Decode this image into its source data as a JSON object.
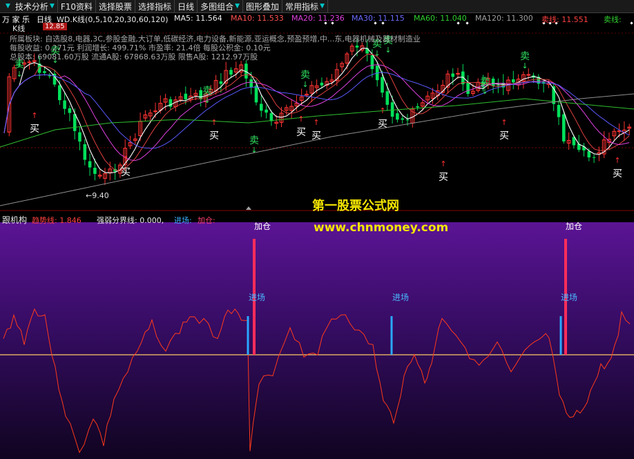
{
  "toolbar": {
    "items": [
      {
        "label": "技术分析",
        "dropdown": true
      },
      {
        "label": "F10资料",
        "dropdown": false
      },
      {
        "label": "选择股票",
        "dropdown": false
      },
      {
        "label": "选择指标",
        "dropdown": false
      },
      {
        "label": "日线",
        "dropdown": false
      },
      {
        "label": "多图组合",
        "dropdown": true
      },
      {
        "label": "图形叠加",
        "dropdown": false
      },
      {
        "label": "常用指标",
        "dropdown": true
      }
    ]
  },
  "stock": {
    "name": "万 家 乐",
    "period": "日线"
  },
  "indicator_line": {
    "name": "WD.K线(0,5,10,20,30,60,120)",
    "ma5": "MA5: 11.564",
    "ma10": "MA10: 11.533",
    "ma20": "MA20: 11.236",
    "ma30": "MA30: 11.115",
    "ma60": "MA60: 11.040",
    "ma120": "MA120: 11.300",
    "sell_line": "卖线: 11.551",
    "sell_line2": "卖线:"
  },
  "kline_label": "K线",
  "kline_badge": "12.85",
  "info": {
    "line1": "所属板块: 自选股8,电器,3C,参股金融,大订单,低碳经济,电力设备,新能源,亚运概念,预盈预增,中...东,电器机械及器材制造业",
    "line2": "每股收益: 0.271元   利润增长: 499.71%   市盈率: 21.4倍   每股公积金: 0.10元",
    "line3": "总股本: 69081.60万股   流通A股: 67868.63万股   限售A股: 1212.97万股"
  },
  "low_marker": "9.40",
  "markers": {
    "buy": "买",
    "sell": "卖"
  },
  "lower_legend": {
    "title": "跟机构",
    "trend": "趋势线: 1.846",
    "strong_weak": "强弱分界线: 0.000,",
    "entry": "进场:",
    "add": "加仓:"
  },
  "signals": {
    "add": "加仓",
    "entry": "进场"
  },
  "watermark": {
    "title": "第一股票公式网",
    "url": "www.chnmoney.com"
  },
  "colors": {
    "up": "#ff3333",
    "down": "#00e05a",
    "ma_white": "#f0f0f0",
    "ma_red": "#e04040",
    "ma_magenta": "#e040e0",
    "ma_blue": "#5a5aff",
    "ma_green": "#30c030",
    "ma_gray": "#909090",
    "trend": "#ff3a1a",
    "entry_bar": "#2aa8ff",
    "add_bar": "#ff2d5a"
  }
}
